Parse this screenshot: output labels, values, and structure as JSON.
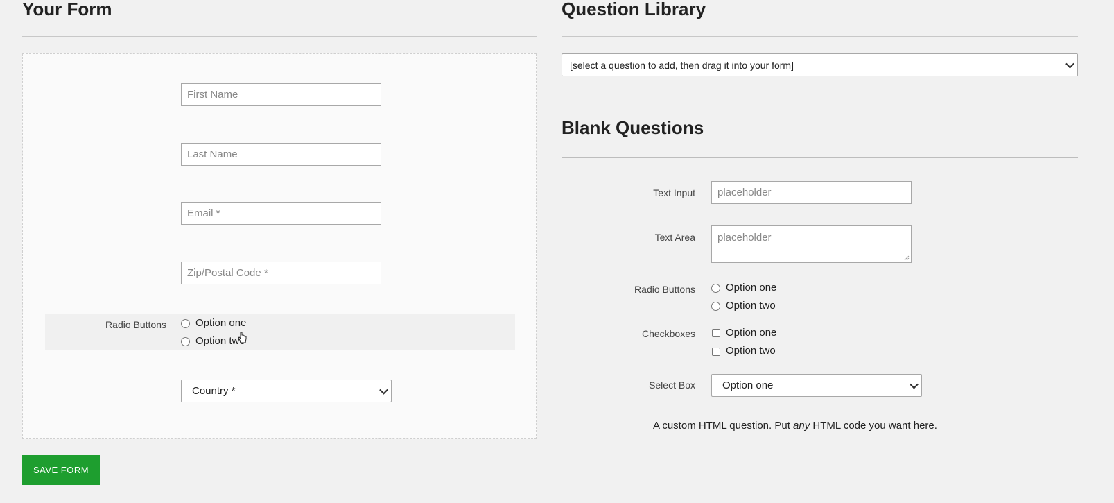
{
  "left": {
    "heading": "Your Form",
    "fields": {
      "first_name_placeholder": "First Name",
      "last_name_placeholder": "Last Name",
      "email_placeholder": "Email *",
      "zip_placeholder": "Zip/Postal Code *"
    },
    "radio": {
      "label": "Radio Buttons",
      "option1": "Option one",
      "option2": "Option two"
    },
    "country": {
      "selected": "Country *"
    },
    "save_label": "SAVE FORM"
  },
  "right": {
    "library_heading": "Question Library",
    "library_select": "[select a question to add, then drag it into your form]",
    "blank_heading": "Blank Questions",
    "text_input": {
      "label": "Text Input",
      "placeholder": "placeholder"
    },
    "text_area": {
      "label": "Text Area",
      "placeholder": "placeholder"
    },
    "radio": {
      "label": "Radio Buttons",
      "option1": "Option one",
      "option2": "Option two"
    },
    "checkboxes": {
      "label": "Checkboxes",
      "option1": "Option one",
      "option2": "Option two"
    },
    "select_box": {
      "label": "Select Box",
      "selected": "Option one"
    },
    "custom_html": {
      "before": "A custom HTML question. Put ",
      "emphasis": "any",
      "after": " HTML code you want here."
    }
  },
  "colors": {
    "save_button": "#1e9e2f",
    "page_bg": "#f1f1f1"
  }
}
